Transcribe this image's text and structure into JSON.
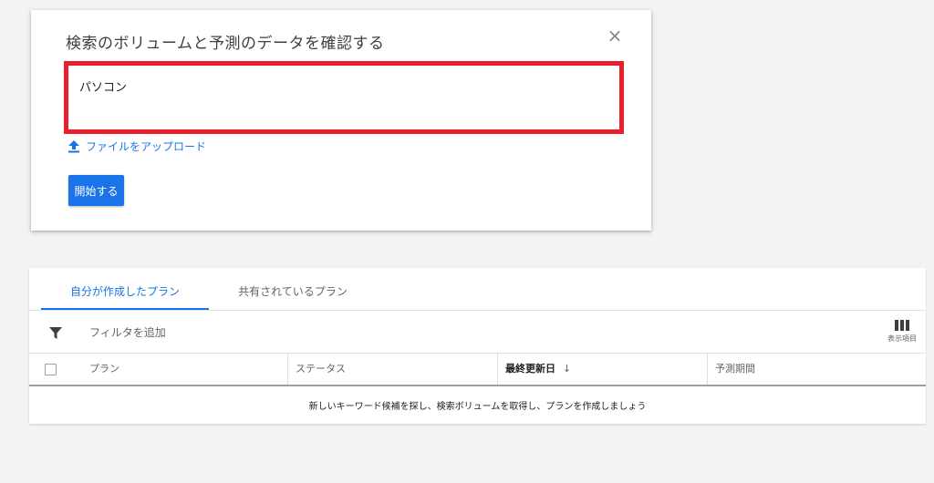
{
  "dialog": {
    "title": "検索のボリュームと予測のデータを確認する",
    "close_icon": "×",
    "keywords_value": "パソコン",
    "upload_link": "ファイルをアップロード",
    "start_button": "開始する"
  },
  "plans": {
    "tabs": [
      {
        "label": "自分が作成したプラン",
        "active": true
      },
      {
        "label": "共有されているプラン",
        "active": false
      }
    ],
    "filter_label": "フィルタを追加",
    "columns_label": "表示項目",
    "table": {
      "headers": [
        "プラン",
        "ステータス",
        "最終更新日",
        "予測期間"
      ],
      "sort_indicator": "↓",
      "empty_message": "新しいキーワード候補を探し、検索ボリュームを取得し、プランを作成しましょう"
    }
  },
  "colors": {
    "accent": "#1a73e8",
    "highlight_border": "#e8202e",
    "background": "#f1f3f4"
  },
  "icons": [
    "close-icon",
    "upload-icon",
    "filter-icon",
    "columns-icon",
    "sort-down-icon"
  ]
}
